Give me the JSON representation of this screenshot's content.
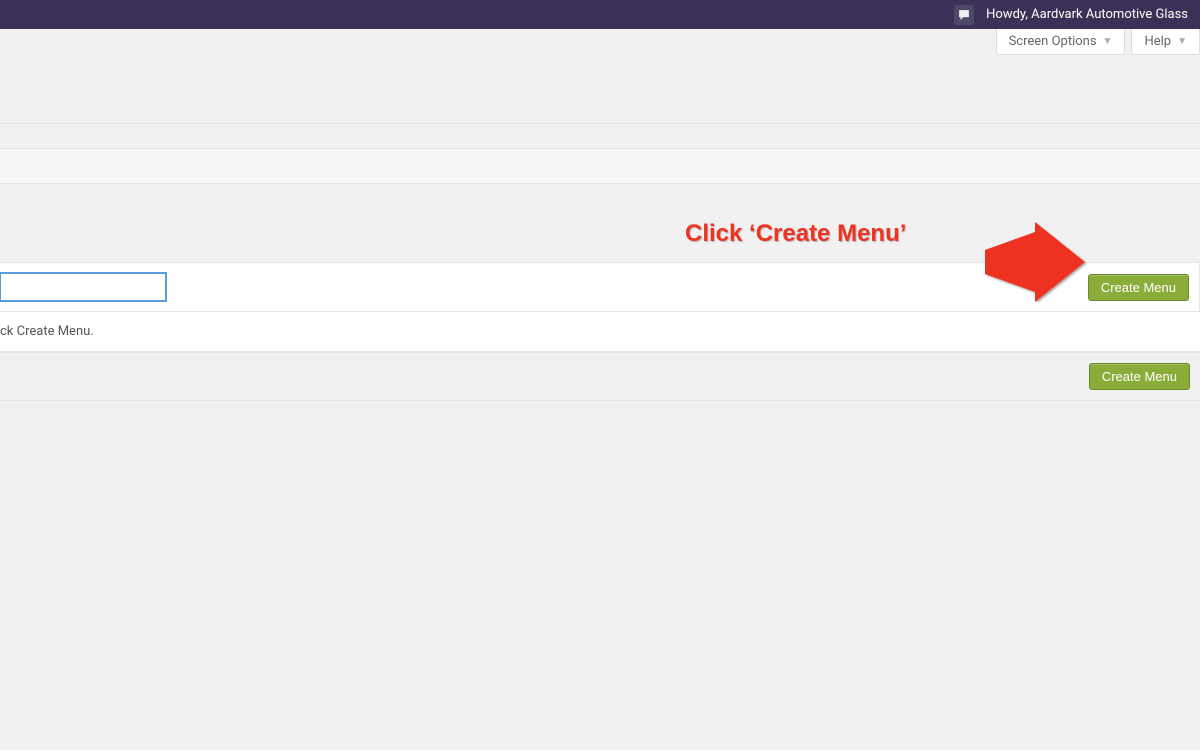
{
  "adminbar": {
    "howdy": "Howdy, Aardvark Automotive Glass"
  },
  "screenMeta": {
    "screenOptions": "Screen Options",
    "help": "Help"
  },
  "menuEdit": {
    "menuNameValue": "",
    "createMenuLabel": "Create Menu",
    "bodyHint": "ck Create Menu."
  },
  "annotation": {
    "text": "Click ‘Create Menu’"
  },
  "colors": {
    "adminbar": "#3b3156",
    "primaryButton": "#8aad3a",
    "annotation": "#e32"
  }
}
